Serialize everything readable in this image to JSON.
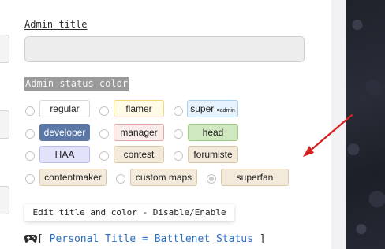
{
  "admin_title": {
    "label": "Admin title",
    "value": "",
    "placeholder": ""
  },
  "admin_status": {
    "label": "Admin status color",
    "options": [
      {
        "name": "regular",
        "bg": "#ffffff",
        "border": "#d8d8d8",
        "color": "#222222"
      },
      {
        "name": "flamer",
        "bg": "#fffbe6",
        "border": "#f0d77a",
        "color": "#222222"
      },
      {
        "name": "super",
        "sub": "=admin",
        "bg": "#e6f3fc",
        "border": "#a9d3ef",
        "color": "#222222"
      },
      {
        "name": "developer",
        "bg": "#5a77a6",
        "border": "#5a77a6",
        "color": "#ffffff"
      },
      {
        "name": "manager",
        "bg": "#fbecec",
        "border": "#e3a6a6",
        "color": "#222222"
      },
      {
        "name": "head",
        "bg": "#cfe8bf",
        "border": "#9ccf84",
        "color": "#222222"
      },
      {
        "name": "HAA",
        "bg": "#e2e3fb",
        "border": "#b9bcee",
        "color": "#222222"
      },
      {
        "name": "contest",
        "bg": "#f3eadc",
        "border": "#dac8a6",
        "color": "#222222"
      },
      {
        "name": "forumiste",
        "bg": "#f3eadc",
        "border": "#dac8a6",
        "color": "#222222"
      },
      {
        "name": "contentmaker",
        "bg": "#f3eadc",
        "border": "#dac8a6",
        "color": "#222222"
      },
      {
        "name": "custom maps",
        "bg": "#f3eadc",
        "border": "#dac8a6",
        "color": "#222222"
      },
      {
        "name": "superfan",
        "bg": "#f3eadc",
        "border": "#dac8a6",
        "color": "#222222",
        "selected": true
      }
    ]
  },
  "edit_button": {
    "label": "Edit title and color - Disable/Enable"
  },
  "footer": {
    "icon": "gamepad-icon",
    "open": "[",
    "text": "Personal Title = Battlenet Status",
    "close": "]"
  },
  "annotation": {
    "color": "#d62020"
  }
}
